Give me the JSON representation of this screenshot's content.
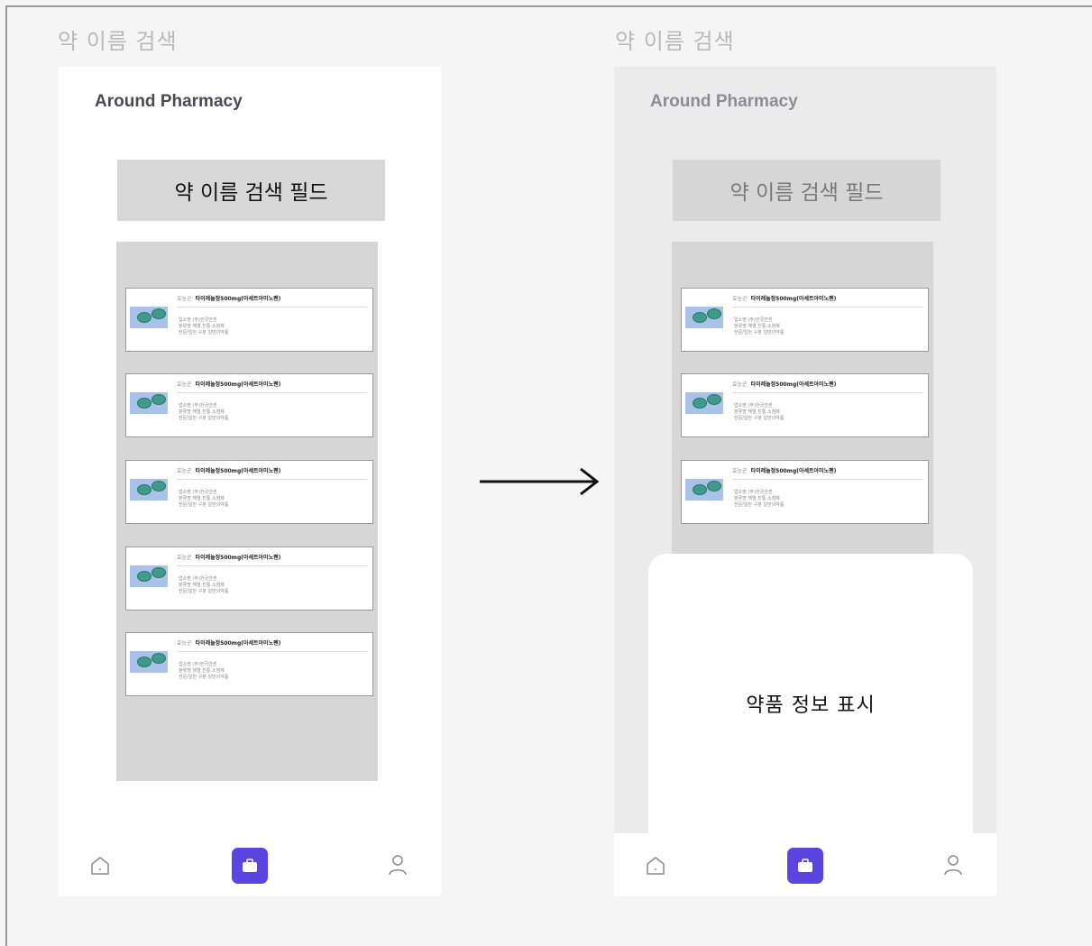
{
  "frames": [
    {
      "label": "약 이름 검색",
      "brand": "Around Pharmacy",
      "search_field": "약 이름 검색 필드",
      "cards": [
        {
          "tag": "효능군",
          "name": "타이레놀정500mg(아세트아미노펜)",
          "info": [
            "업소명 (주)한국얀센",
            "분류명 해열.진통.소염제",
            "전문/일반 구분 일반의약품"
          ]
        },
        {
          "tag": "효능군",
          "name": "타이레놀정500mg(아세트아미노펜)",
          "info": [
            "업소명 (주)한국얀센",
            "분류명 해열.진통.소염제",
            "전문/일반 구분 일반의약품"
          ]
        },
        {
          "tag": "효능군",
          "name": "타이레놀정500mg(아세트아미노펜)",
          "info": [
            "업소명 (주)한국얀센",
            "분류명 해열.진통.소염제",
            "전문/일반 구분 일반의약품"
          ]
        },
        {
          "tag": "효능군",
          "name": "타이레놀정500mg(아세트아미노펜)",
          "info": [
            "업소명 (주)한국얀센",
            "분류명 해열.진통.소염제",
            "전문/일반 구분 일반의약품"
          ]
        },
        {
          "tag": "효능군",
          "name": "타이레놀정500mg(아세트아미노펜)",
          "info": [
            "업소명 (주)한국얀센",
            "분류명 해열.진통.소염제",
            "전문/일반 구분 일반의약품"
          ]
        }
      ]
    },
    {
      "label": "약 이름 검색",
      "brand": "Around Pharmacy",
      "search_field": "약 이름 검색 필드",
      "cards": [
        {
          "tag": "효능군",
          "name": "타이레놀정500mg(아세트아미노펜)",
          "info": [
            "업소명 (주)한국얀센",
            "분류명 해열.진통.소염제",
            "전문/일반 구분 일반의약품"
          ]
        },
        {
          "tag": "효능군",
          "name": "타이레놀정500mg(아세트아미노펜)",
          "info": [
            "업소명 (주)한국얀센",
            "분류명 해열.진통.소염제",
            "전문/일반 구분 일반의약품"
          ]
        },
        {
          "tag": "효능군",
          "name": "타이레놀정500mg(아세트아미노펜)",
          "info": [
            "업소명 (주)한국얀센",
            "분류명 해열.진통.소염제",
            "전문/일반 구분 일반의약품"
          ]
        }
      ],
      "sheet_text": "약품 정보  표시"
    }
  ],
  "nav": {
    "home_icon": "home-icon",
    "center_icon": "pill-bag-icon",
    "profile_icon": "user-icon",
    "accent": "#5b45e0"
  }
}
